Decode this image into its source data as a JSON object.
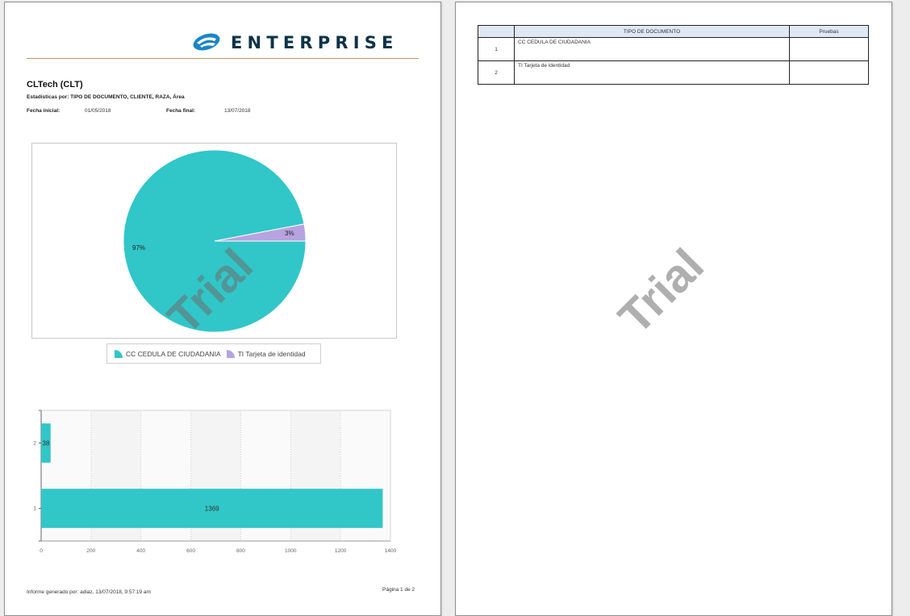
{
  "header": {
    "logo_text": "ENTERPRISE",
    "title": "CLTech (CLT)",
    "subtitle": "Estadisticas por: TIPO DE DOCUMENTO, CLIENTE, RAZA, Área",
    "start_label": "Fecha inicial:",
    "start_value": "01/05/2018",
    "end_label": "Fecha final:",
    "end_value": "13/07/2018"
  },
  "colors": {
    "teal": "#31c6c8",
    "purple": "#b6a3e0",
    "navy": "#0d3347",
    "gold": "#b89a57"
  },
  "chart_data": [
    {
      "type": "pie",
      "slices": [
        {
          "label": "CC CEDULA DE CIUDADANIA",
          "value": 97,
          "display": "97%",
          "color": "#31c6c8"
        },
        {
          "label": "TI Tarjeta de identidad",
          "value": 3,
          "display": "3%",
          "color": "#b6a3e0"
        }
      ],
      "legend": "bottom"
    },
    {
      "type": "bar",
      "orientation": "horizontal",
      "categories": [
        "2",
        "1"
      ],
      "values": [
        38,
        1369
      ],
      "xlim": [
        0,
        1400
      ],
      "xticks": [
        "0",
        "200",
        "400",
        "600",
        "800",
        "1000",
        "1200",
        "1400"
      ],
      "grid": true
    }
  ],
  "watermark": "Trial",
  "footer": {
    "generated": "Informe generado por: adiaz, 13/07/2018, 9:57:19 am",
    "page": "Página 1 de 2"
  },
  "table": {
    "headers": [
      "",
      "TIPO DE DOCUMENTO",
      "Pruebas"
    ],
    "rows": [
      {
        "num": "1",
        "tipo": "CC CEDULA DE CIUDADANIA",
        "pruebas": ""
      },
      {
        "num": "2",
        "tipo": "TI Tarjeta de identidad",
        "pruebas": ""
      }
    ]
  }
}
